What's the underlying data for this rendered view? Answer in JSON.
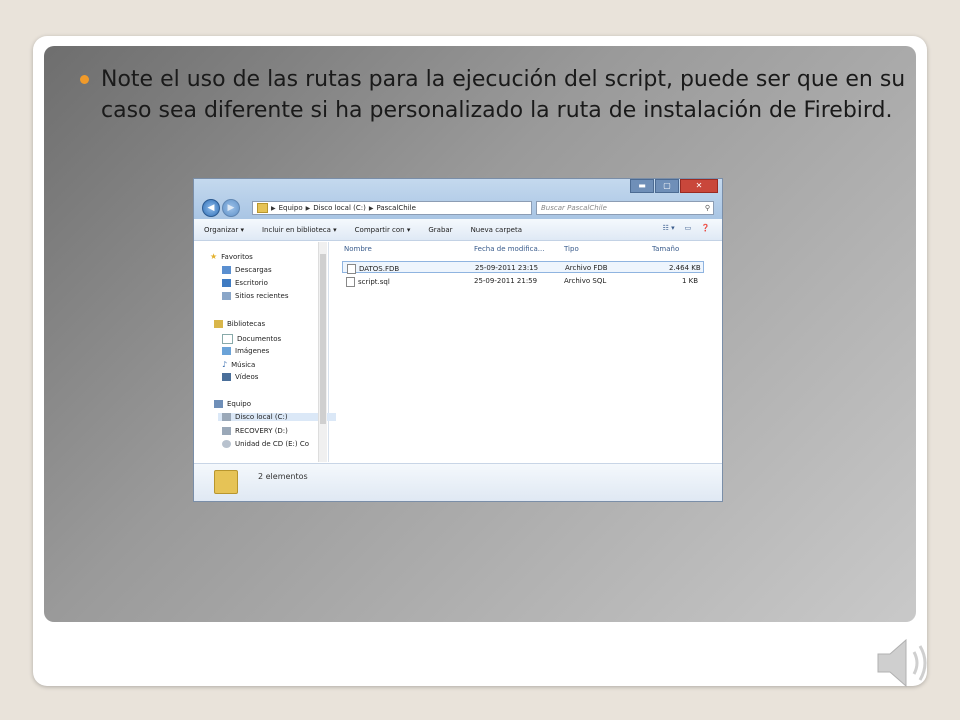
{
  "slide": {
    "bullet_text": "Note el uso de las rutas para la ejecución del script, puede ser que en su caso sea diferente si ha personalizado la ruta de instalación de Firebird."
  },
  "explorer": {
    "window_buttons": {
      "minimize": "▬",
      "maximize": "▢",
      "close": "✕"
    },
    "address_segments": [
      "Equipo",
      "Disco local (C:)",
      "PascalChile"
    ],
    "search_placeholder": "Buscar PascalChile",
    "toolbar": [
      "Organizar ▾",
      "Incluir en biblioteca ▾",
      "Compartir con ▾",
      "Grabar",
      "Nueva carpeta"
    ],
    "nav": {
      "favorites": "Favoritos",
      "fav_items": [
        "Descargas",
        "Escritorio",
        "Sitios recientes"
      ],
      "libraries": "Bibliotecas",
      "lib_items": [
        "Documentos",
        "Imágenes",
        "Música",
        "Vídeos"
      ],
      "computer": "Equipo",
      "comp_items": [
        "Disco local (C:)",
        "RECOVERY (D:)",
        "Unidad de CD (E:) Co"
      ]
    },
    "columns": [
      "Nombre",
      "Fecha de modifica...",
      "Tipo",
      "Tamaño"
    ],
    "files": [
      {
        "name": "DATOS.FDB",
        "date": "25-09-2011 23:15",
        "type": "Archivo FDB",
        "size": "2.464 KB"
      },
      {
        "name": "script.sql",
        "date": "25-09-2011 21:59",
        "type": "Archivo SQL",
        "size": "1 KB"
      }
    ],
    "status": "2 elementos"
  }
}
